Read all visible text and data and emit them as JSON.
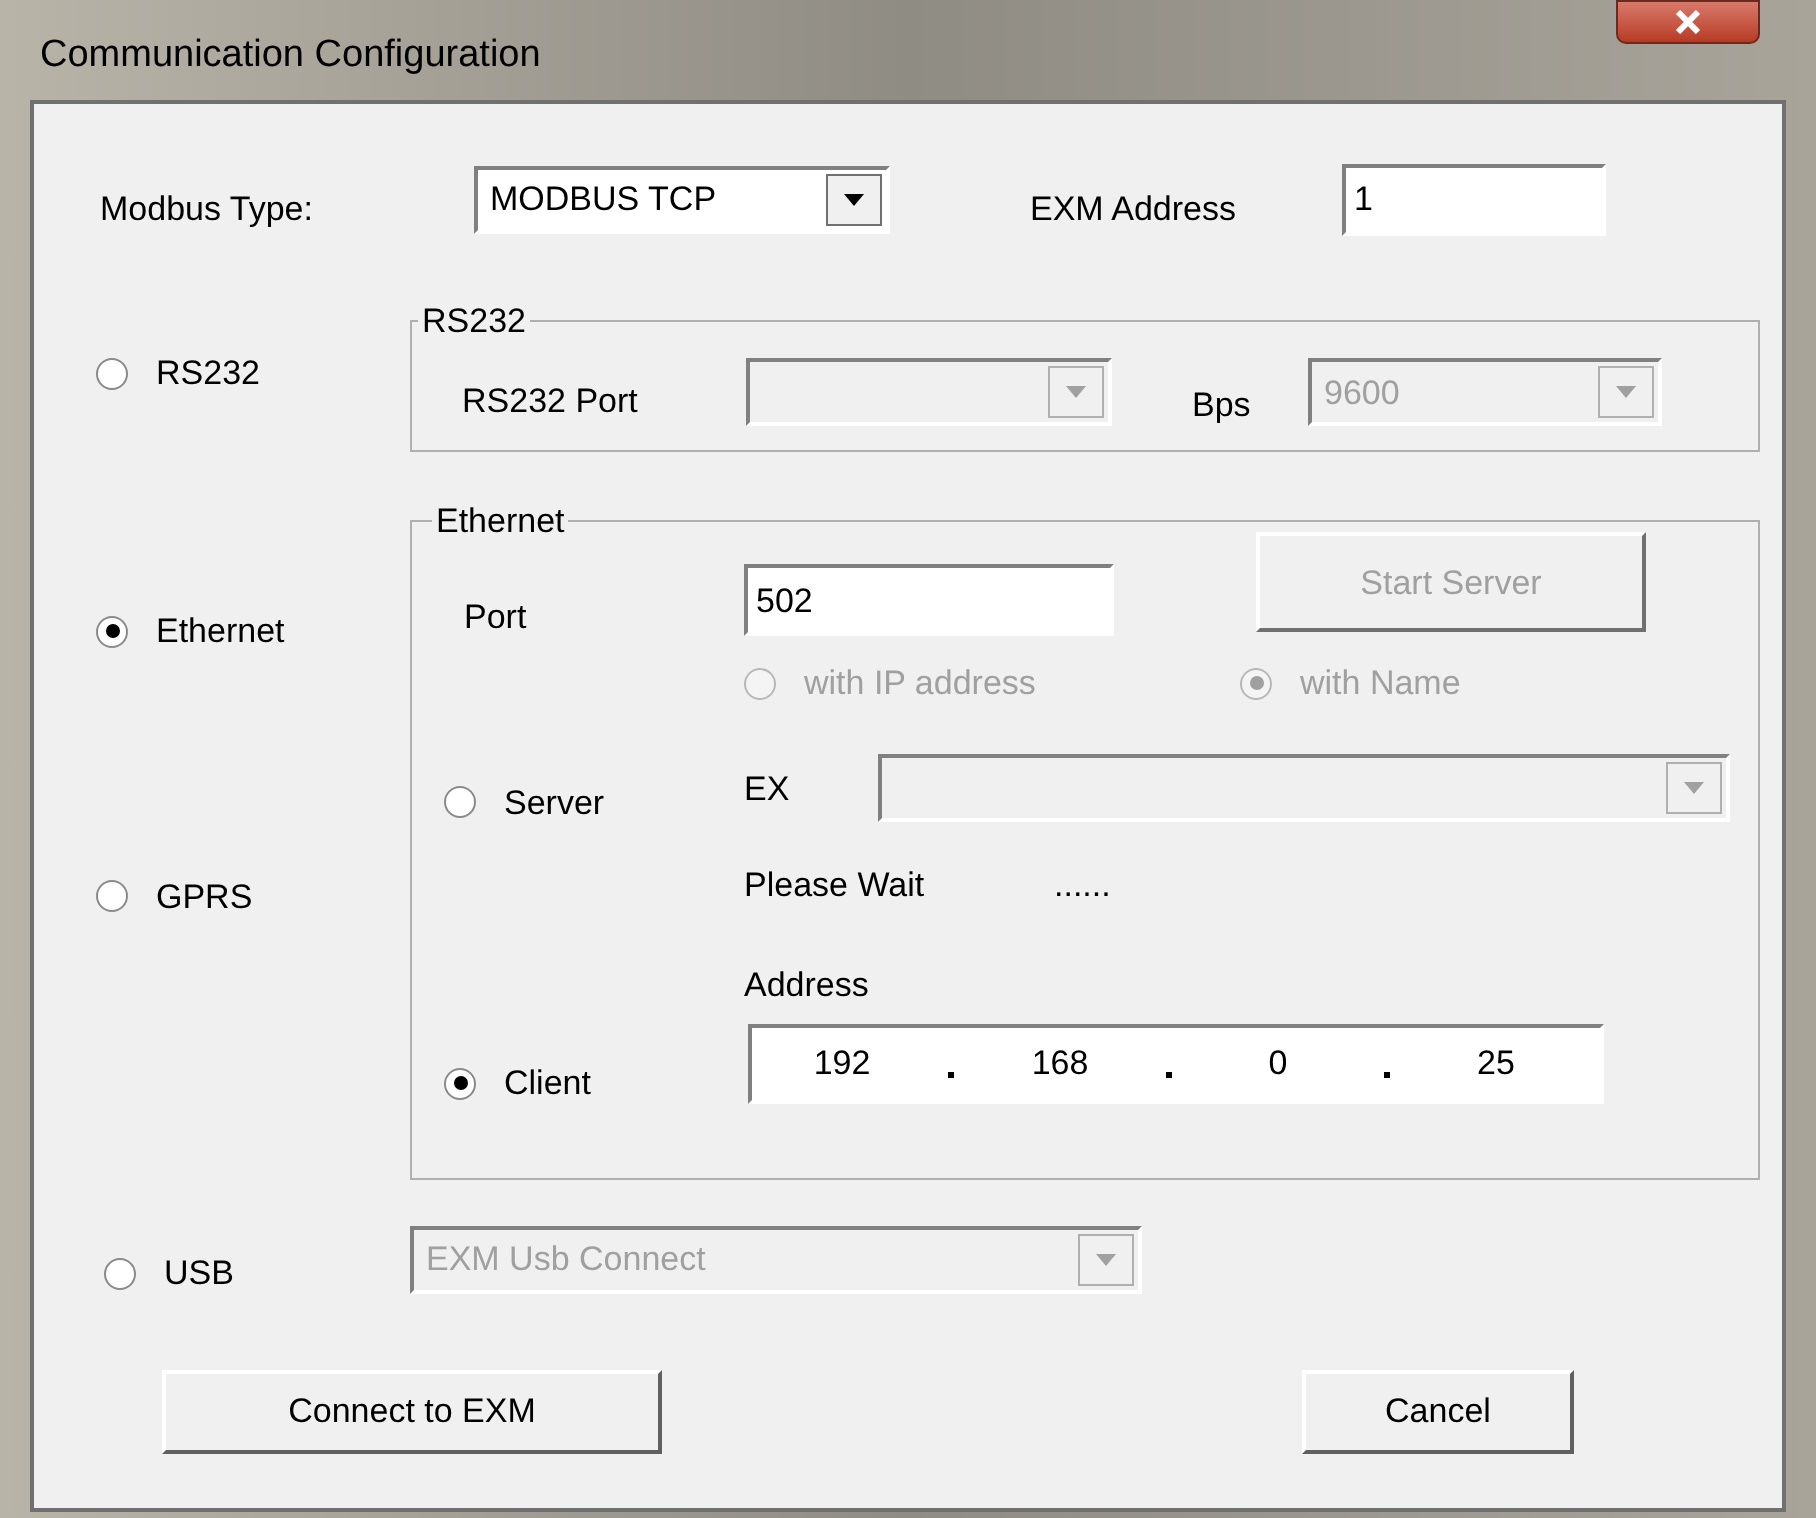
{
  "window": {
    "title": "Communication Configuration"
  },
  "modbus_type": {
    "label": "Modbus Type:",
    "value": "MODBUS TCP"
  },
  "exm_address": {
    "label": "EXM Address",
    "value": "1"
  },
  "connection_types": [
    {
      "label": "RS232",
      "selected": false
    },
    {
      "label": "Ethernet",
      "selected": true
    },
    {
      "label": "GPRS",
      "selected": false
    },
    {
      "label": "USB",
      "selected": false
    }
  ],
  "rs232": {
    "title": "RS232",
    "port_label": "RS232 Port",
    "port_disabled": true,
    "bps_label": "Bps",
    "bps_value": "9600",
    "bps_disabled": true
  },
  "ethernet": {
    "title": "Ethernet",
    "port_label": "Port",
    "port_value": "502",
    "start_server": {
      "label": "Start Server",
      "disabled": true
    },
    "lookup_modes": [
      {
        "label": "with IP address",
        "selected": false,
        "disabled": true
      },
      {
        "label": "with Name",
        "selected": true,
        "disabled": true
      }
    ],
    "roles": [
      {
        "label": "Server",
        "selected": false
      },
      {
        "label": "Client",
        "selected": true
      }
    ],
    "exm_label": "EX",
    "exm_disabled": true,
    "status": "Please Wait",
    "status_dots": "......",
    "address_label": "Address",
    "address_octets": [
      "192",
      "168",
      "0",
      "25"
    ]
  },
  "usb": {
    "device": "EXM Usb Connect",
    "disabled": true
  },
  "buttons": [
    {
      "label": "Connect to EXM"
    },
    {
      "label": "Cancel"
    }
  ]
}
